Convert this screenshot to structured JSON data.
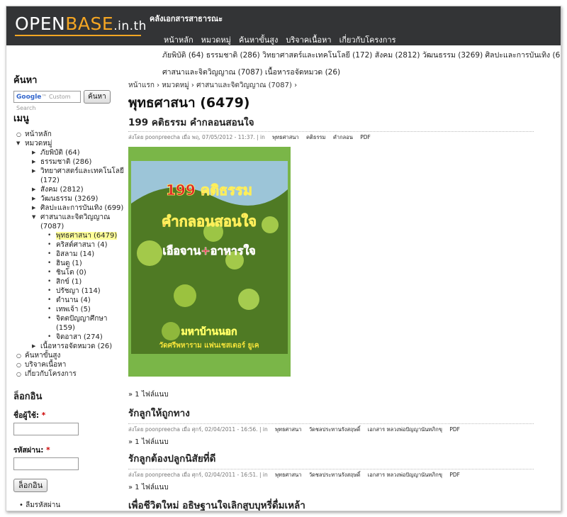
{
  "header": {
    "logo_part1": "OPEN",
    "logo_part2": "BASE",
    "logo_part3": ".in.th",
    "slogan": "คลังเอกสารสาธารณะ",
    "nav": [
      "หน้าหลัก",
      "หมวดหมู่",
      "ค้นหาขั้นสูง",
      "บริจาคเนื้อหา",
      "เกี่ยวกับโครงการ"
    ]
  },
  "categories": {
    "row1": "ภัยพิบัติ (64)  ธรรมชาติ (286)  วิทยาศาสตร์และเทคโนโลยี (172)  สังคม (2812)  วัฒนธรรม (3269)  ศิลปะและการบันเทิง (699)",
    "row2": "ศาสนาและจิตวิญญาณ (7087)  เนื้อหารอจัดหมวด (26)"
  },
  "sidebar": {
    "search_title": "ค้นหา",
    "search_placeholder": "Custom Search",
    "search_button": "ค้นหา",
    "menu_title": "เมนู",
    "home": "หน้าหลัก",
    "categories": "หมวดหมู่",
    "cat_items": [
      "ภัยพิบัติ (64)",
      "ธรรมชาติ (286)",
      "วิทยาศาสตร์และเทคโนโลยี (172)",
      "สังคม (2812)",
      "วัฒนธรรม (3269)",
      "ศิลปะและการบันเทิง (699)"
    ],
    "religion": "ศาสนาและจิตวิญญาณ (7087)",
    "religion_items": [
      "พุทธศาสนา (6479)",
      "คริสต์ศาสนา (4)",
      "อิสลาม (14)",
      "ฮินดู (1)",
      "ชินโต (0)",
      "สิกข์ (1)",
      "ปรัชญา (114)",
      "ตำนาน (4)",
      "เทพเจ้า (5)",
      "จิตตปัญญาศึกษา (159)",
      "จิตอาสา (274)"
    ],
    "uncategorized": "เนื้อหารอจัดหมวด (26)",
    "advanced_search": "ค้นหาขั้นสูง",
    "donate": "บริจาคเนื้อหา",
    "about": "เกี่ยวกับโครงการ",
    "login_title": "ล็อกอิน",
    "username_label": "ชื่อผู้ใช้:",
    "password_label": "รหัสผ่าน:",
    "required_mark": "*",
    "login_button": "ล็อกอิน",
    "forgot_password": "ลืมรหัสผ่าน"
  },
  "main": {
    "breadcrumb": "หน้าแรก › หมวดหมู่ › ศาสนาและจิตวิญญาณ (7087) ›",
    "page_title": "พุทธศาสนา (6479)",
    "cover_text1": "199 คติธรรม",
    "cover_text2": "คำกลอนสอนใจ",
    "cover_text3": "เอือจาน+อาหารใจ",
    "cover_text4": "มหาบ้านนอก",
    "cover_text5": "วัดศรีพหาราม แฟนเชสเตอร์ ยูเค",
    "nodes": [
      {
        "title": "199 คติธรรม คำกลอนสอนใจ",
        "meta": "ส่งโดย poonpreecha เมื่อ พฤ, 07/05/2012 - 11:37. | in",
        "tags": [
          "พุทธศาสนา",
          "คติธรรม",
          "คำกลอน",
          "PDF"
        ],
        "attach": "» 1 ไฟล์แนบ"
      },
      {
        "title": "รักลูกให้ถูกทาง",
        "meta": "ส่งโดย poonpreecha เมื่อ ศุกร์, 02/04/2011 - 16:56. | in",
        "tags": [
          "พุทธศาสนา",
          "วัดชลประทานรังสฤษดิ์",
          "เอกสาร หลวงพ่อปัญญานันทภิกขุ",
          "PDF"
        ],
        "attach": "» 1 ไฟล์แนบ"
      },
      {
        "title": "รักลูกต้องปลูกนิสัยที่ดี",
        "meta": "ส่งโดย poonpreecha เมื่อ ศุกร์, 02/04/2011 - 16:51. | in",
        "tags": [
          "พุทธศาสนา",
          "วัดชลประทานรังสฤษดิ์",
          "เอกสาร หลวงพ่อปัญญานันทภิกขุ",
          "PDF"
        ],
        "attach": "» 1 ไฟล์แนบ"
      },
      {
        "title": "เพื่อชีวิตใหม่ อธิษฐานใจเลิกสูบบุหรี่ดื่มเหล้า"
      }
    ]
  },
  "colors": {
    "header_bg": "#333436",
    "logo_accent": "#f5a623",
    "highlight": "#ffff99",
    "cover_border": "#7ab648"
  }
}
